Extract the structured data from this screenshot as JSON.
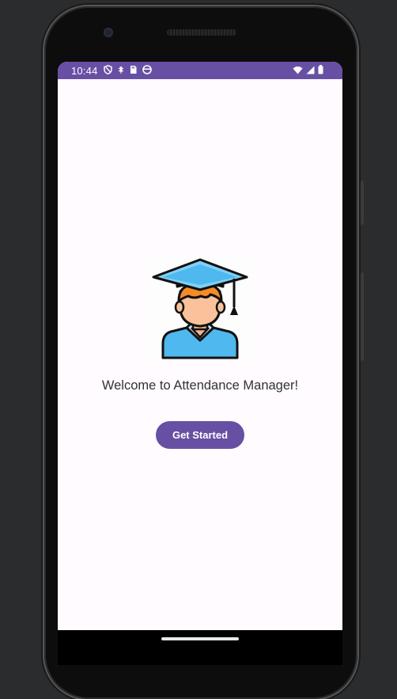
{
  "status_bar": {
    "time": "10:44",
    "left_icons": [
      "shield-icon",
      "bug-icon",
      "sd-card-icon",
      "face-icon"
    ],
    "right_icons": [
      "wifi-icon",
      "signal-icon",
      "battery-icon"
    ],
    "color": "#6750a4"
  },
  "main": {
    "hero_image": "graduate-student-icon",
    "welcome_text": "Welcome to Attendance Manager!",
    "get_started_label": "Get Started"
  },
  "theme": {
    "primary": "#6750a4",
    "background": "#fffbfe"
  }
}
